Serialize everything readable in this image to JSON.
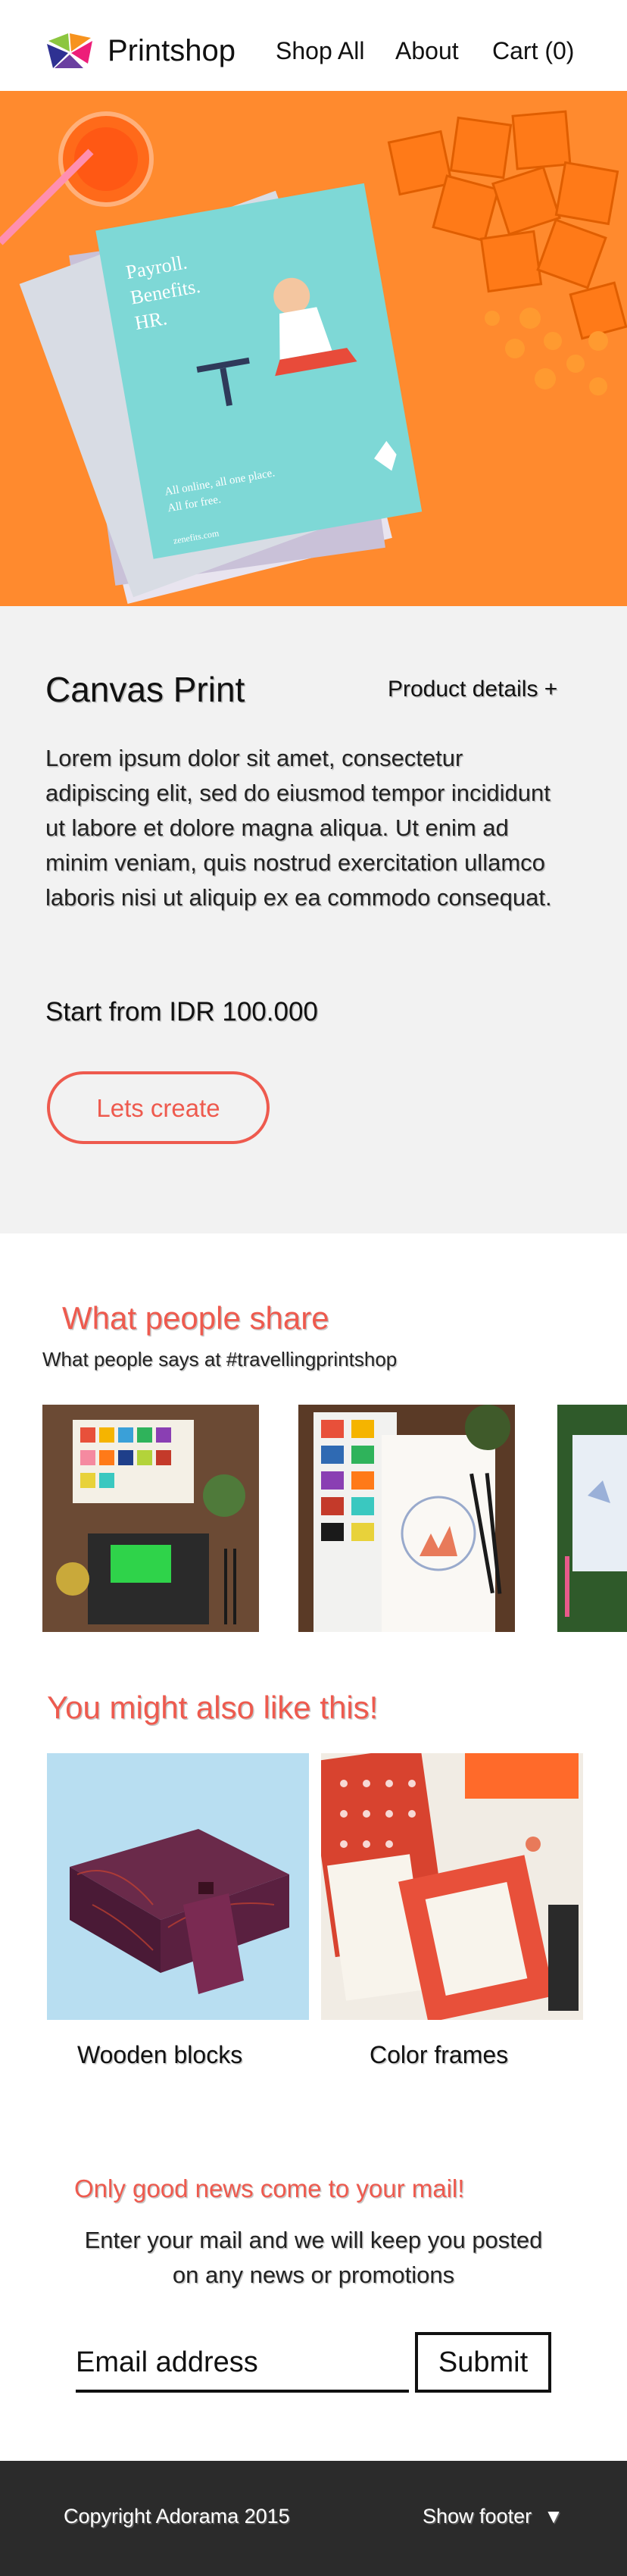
{
  "header": {
    "brand": "Printshop",
    "nav": {
      "shop_all": "Shop All",
      "about": "About",
      "cart": "Cart (0)"
    }
  },
  "hero": {
    "poster_text": [
      "Payroll.",
      "Benefits.",
      "HR."
    ],
    "poster_tagline": [
      "All online, all one place.",
      "All for free."
    ],
    "poster_url": "zenefits.com"
  },
  "product": {
    "title": "Canvas Print",
    "details_link": "Product details +",
    "description": "Lorem ipsum dolor sit amet, consectetur adipiscing elit, sed do eiusmod tempor incididunt ut labore et dolore magna aliqua. Ut enim ad minim veniam, quis nostrud exercitation ullamco laboris nisi ut aliquip ex ea commodo consequat.",
    "price": "Start from IDR 100.000",
    "cta": "Lets create"
  },
  "share": {
    "title": "What people share",
    "subtitle": "What people says at #travellingprintshop"
  },
  "related": {
    "title": "You might also like this!",
    "items": [
      {
        "name": "Wooden blocks"
      },
      {
        "name": "Color frames"
      }
    ]
  },
  "newsletter": {
    "title": "Only good news come to your mail!",
    "text": "Enter your mail and we will keep you posted on any news or promotions",
    "email_placeholder": "Email address",
    "submit": "Submit"
  },
  "footer": {
    "copyright": "Copyright Adorama 2015",
    "show_footer": "Show footer",
    "caret_icon": "triangle-down-icon"
  },
  "colors": {
    "accent": "#ee5a4e",
    "hero_bg": "#ff8a2e",
    "section_bg": "#f2f2f2",
    "footer_bg": "#2b2b2b"
  }
}
